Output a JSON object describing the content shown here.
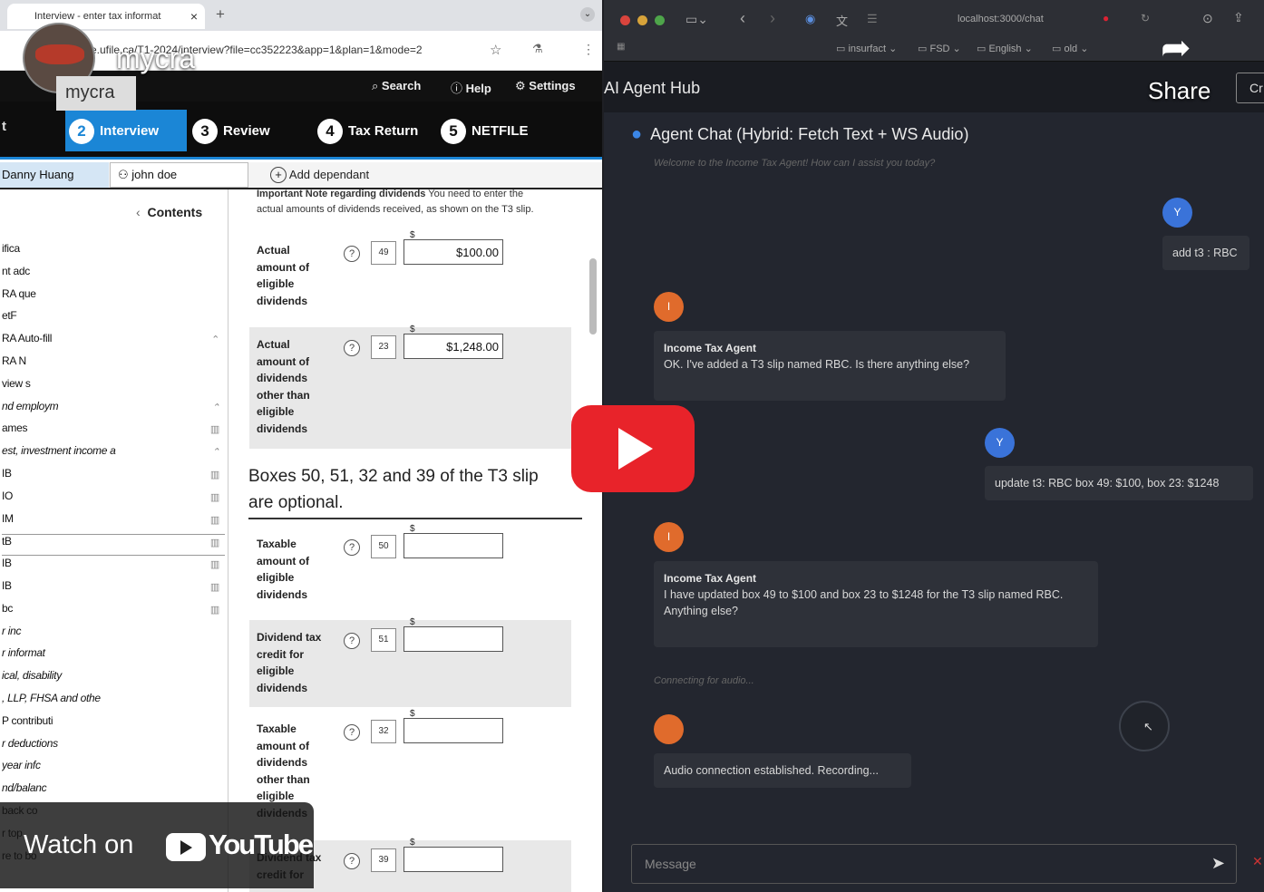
{
  "browser": {
    "tab_title": "Interview - enter tax informat",
    "tab_close": "×",
    "new_tab": "+",
    "url": "e.ufile.ca/T1-2024/interview?file=cc352223&app=1&plan=1&mode=2"
  },
  "video": {
    "channel_name": "mycra",
    "channel_label": "mycra",
    "share_label": "Share",
    "watch_on_label": "Watch on",
    "youtube_label": "YouTube"
  },
  "ufile": {
    "header": {
      "search": "Search",
      "help": "Help",
      "settings": "Settings"
    },
    "steps": [
      {
        "num": "2",
        "label": "Interview"
      },
      {
        "num": "3",
        "label": "Review"
      },
      {
        "num": "4",
        "label": "Tax Return"
      },
      {
        "num": "5",
        "label": "NETFILE"
      }
    ],
    "step_fragment": "t",
    "people": {
      "primary": "Danny Huang",
      "secondary": "john doe",
      "add_dependant": "Add dependant"
    },
    "contents_label": "Contents",
    "sidebar_items": [
      "ifica",
      "nt adc",
      "RA que",
      "etF",
      "RA Auto-fill",
      "RA N",
      "view s",
      "nd employm",
      "ames",
      "est, investment income a",
      "IB",
      "IO",
      "IM",
      "tB",
      "IB",
      "IB",
      "bc",
      "r inc",
      "r informat",
      "ical, disability",
      ", LLP, FHSA and othe",
      "P contributi",
      "r deductions",
      "year infc",
      "nd/balanc",
      "back co",
      "r top",
      "re to bo"
    ],
    "form": {
      "note_heading": "Important Note regarding dividends",
      "note_text_1": "You need to enter the",
      "note_text_2": "actual amounts of dividends received, as shown on the T3 slip.",
      "optional_heading_1": "Boxes 50, 51, 32 and 39 of the T3 slip",
      "optional_heading_2": "are optional.",
      "fields": [
        {
          "label": "Actual amount of eligible dividends",
          "box": "49",
          "value": "$100.00"
        },
        {
          "label": "Actual amount of dividends other than eligible dividends",
          "box": "23",
          "value": "$1,248.00"
        },
        {
          "label": "Taxable amount of eligible dividends",
          "box": "50",
          "value": ""
        },
        {
          "label": "Dividend tax credit for eligible dividends",
          "box": "51",
          "value": ""
        },
        {
          "label": "Taxable amount of dividends other than eligible dividends",
          "box": "32",
          "value": ""
        },
        {
          "label": "Dividend tax credit for",
          "box": "39",
          "value": ""
        }
      ],
      "dollar_sign": "$",
      "qmark": "?"
    }
  },
  "chat": {
    "address": "localhost:3000/chat",
    "bookmarks": [
      "insurfact",
      "FSD",
      "English",
      "old"
    ],
    "hub_title": "AI Agent Hub",
    "hub_button": "Cr",
    "panel_title": "Agent Chat (Hybrid: Fetch Text + WS Audio)",
    "welcome": "Welcome to the Income Tax Agent! How can I assist you today?",
    "messages": [
      {
        "role": "user",
        "avatar": "Y",
        "text": "add t3 : RBC"
      },
      {
        "role": "agent",
        "avatar": "I",
        "sender": "Income Tax Agent",
        "text": "OK. I've added a T3 slip named RBC. Is there anything else?"
      },
      {
        "role": "user",
        "avatar": "Y",
        "text": "update t3: RBC box 49: $100, box 23: $1248"
      },
      {
        "role": "agent",
        "avatar": "I",
        "sender": "Income Tax Agent",
        "text": "I have updated box 49 to $100 and box 23 to $1248 for the T3 slip named RBC. Anything else?"
      },
      {
        "role": "agent",
        "avatar": "",
        "text": "Audio connection established. Recording..."
      }
    ],
    "status": "Connecting for audio...",
    "input_placeholder": "Message"
  },
  "colors": {
    "accent": "#1b86d6",
    "user_avatar": "#3a73d9",
    "agent_avatar": "#e06b2c",
    "youtube_red": "#e8232a"
  }
}
